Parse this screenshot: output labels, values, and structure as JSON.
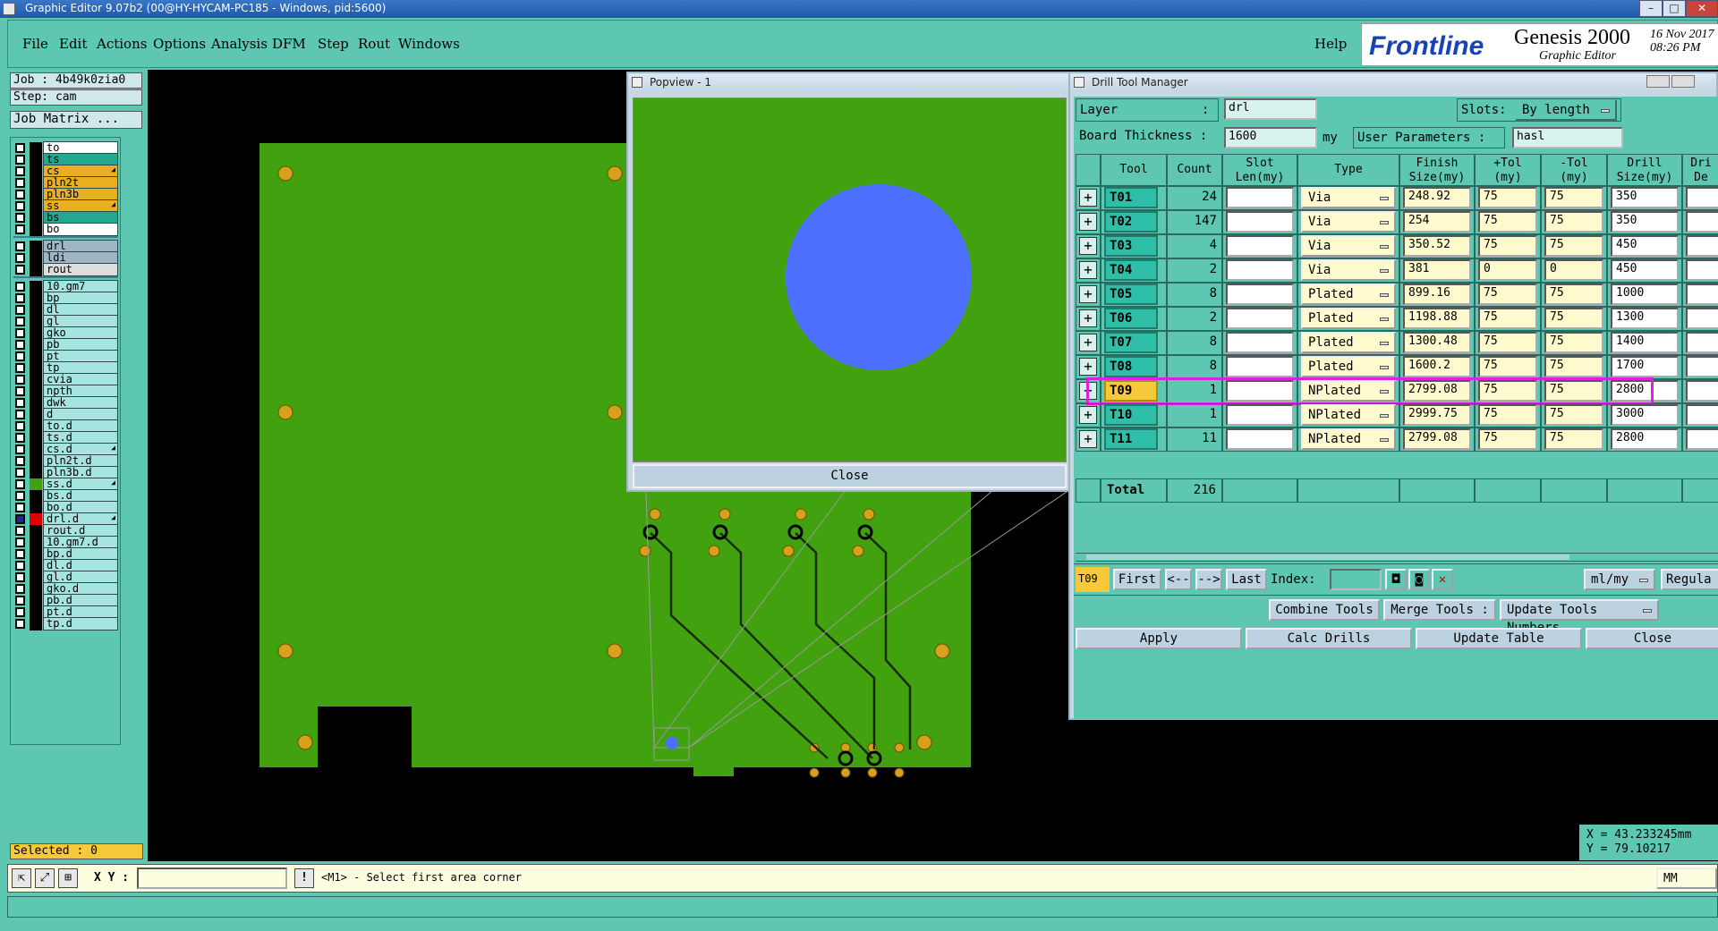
{
  "window": {
    "title": "Graphic Editor 9.07b2 (00@HY-HYCAM-PC185 - Windows, pid:5600)"
  },
  "menu": [
    "File",
    "Edit",
    "Actions",
    "Options",
    "Analysis",
    "DFM",
    "Step",
    "Rout",
    "Windows"
  ],
  "help_label": "Help",
  "brand": {
    "logo": "Frontline",
    "product": "Genesis 2000",
    "sub": "Graphic Editor",
    "date": "16 Nov 2017",
    "time": "08:26 PM"
  },
  "left": {
    "job": "Job : 4b49k0zia0",
    "step": "Step: cam",
    "job_matrix": "Job Matrix ...",
    "selected": "Selected : 0"
  },
  "layers": [
    {
      "name": "to",
      "color": "#ffffff",
      "g": 0
    },
    {
      "name": "ts",
      "color": "#23a98f",
      "g": 0
    },
    {
      "name": "cs",
      "color": "#e8b020",
      "g": 0,
      "mark": true
    },
    {
      "name": "pln2t",
      "color": "#e8b020",
      "g": 0
    },
    {
      "name": "pln3b",
      "color": "#e8b020",
      "g": 0
    },
    {
      "name": "ss",
      "color": "#e8b020",
      "g": 0,
      "mark": true
    },
    {
      "name": "bs",
      "color": "#23a98f",
      "g": 0
    },
    {
      "name": "bo",
      "color": "#ffffff",
      "g": 0
    },
    {
      "name": "drl",
      "color": "#9fb6c6",
      "g": 1
    },
    {
      "name": "ldi",
      "color": "#9fb6c6",
      "g": 1
    },
    {
      "name": "rout",
      "color": "#dddddd",
      "g": 1
    },
    {
      "name": "10.gm7",
      "color": "#a6e4e0",
      "g": 2
    },
    {
      "name": "bp",
      "color": "#a6e4e0",
      "g": 2
    },
    {
      "name": "dl",
      "color": "#a6e4e0",
      "g": 2
    },
    {
      "name": "gl",
      "color": "#a6e4e0",
      "g": 2
    },
    {
      "name": "gko",
      "color": "#a6e4e0",
      "g": 2
    },
    {
      "name": "pb",
      "color": "#a6e4e0",
      "g": 2
    },
    {
      "name": "pt",
      "color": "#a6e4e0",
      "g": 2
    },
    {
      "name": "tp",
      "color": "#a6e4e0",
      "g": 2
    },
    {
      "name": "cvia",
      "color": "#a6e4e0",
      "g": 2
    },
    {
      "name": "npth",
      "color": "#a6e4e0",
      "g": 2
    },
    {
      "name": "dwk",
      "color": "#a6e4e0",
      "g": 2
    },
    {
      "name": "d",
      "color": "#a6e4e0",
      "g": 2
    },
    {
      "name": "to.d",
      "color": "#a6e4e0",
      "g": 2
    },
    {
      "name": "ts.d",
      "color": "#a6e4e0",
      "g": 2
    },
    {
      "name": "cs.d",
      "color": "#a6e4e0",
      "g": 2,
      "mark": true
    },
    {
      "name": "pln2t.d",
      "color": "#a6e4e0",
      "g": 2
    },
    {
      "name": "pln3b.d",
      "color": "#a6e4e0",
      "g": 2
    },
    {
      "name": "ss.d",
      "color": "#a6e4e0",
      "g": 2,
      "mark": true,
      "sw": "#41a10f"
    },
    {
      "name": "bs.d",
      "color": "#a6e4e0",
      "g": 2
    },
    {
      "name": "bo.d",
      "color": "#a6e4e0",
      "g": 2
    },
    {
      "name": "drl.d",
      "color": "#a6e4e0",
      "g": 2,
      "mark": true,
      "sw": "#e00000"
    },
    {
      "name": "rout.d",
      "color": "#a6e4e0",
      "g": 2
    },
    {
      "name": "10.gm7.d",
      "color": "#a6e4e0",
      "g": 2
    },
    {
      "name": "bp.d",
      "color": "#a6e4e0",
      "g": 2
    },
    {
      "name": "dl.d",
      "color": "#a6e4e0",
      "g": 2
    },
    {
      "name": "gl.d",
      "color": "#a6e4e0",
      "g": 2
    },
    {
      "name": "gko.d",
      "color": "#a6e4e0",
      "g": 2
    },
    {
      "name": "pb.d",
      "color": "#a6e4e0",
      "g": 2
    },
    {
      "name": "pt.d",
      "color": "#a6e4e0",
      "g": 2
    },
    {
      "name": "tp.d",
      "color": "#a6e4e0",
      "g": 2
    }
  ],
  "popview": {
    "title": "Popview - 1",
    "close": "Close"
  },
  "dtm": {
    "title": "Drill Tool Manager",
    "layer_label": "Layer",
    "layer_colon": ":",
    "layer_value": "drl",
    "slots_label": "Slots:",
    "slots_value": "By length",
    "board_label": "Board Thickness :",
    "board_value": "1600",
    "board_unit": "my",
    "user_params": "User Parameters :",
    "user_value": "hasl",
    "headers": [
      "Tool",
      "Count",
      "Slot Len(my)",
      "Type",
      "Finish Size(my)",
      "+Tol (my)",
      "-Tol (my)",
      "Drill Size(my)",
      "Dri De"
    ],
    "rows": [
      {
        "tool": "T01",
        "count": "24",
        "type": "Via",
        "finish": "248.92",
        "ptol": "75",
        "mtol": "75",
        "drill": "350"
      },
      {
        "tool": "T02",
        "count": "147",
        "type": "Via",
        "finish": "254",
        "ptol": "75",
        "mtol": "75",
        "drill": "350"
      },
      {
        "tool": "T03",
        "count": "4",
        "type": "Via",
        "finish": "350.52",
        "ptol": "75",
        "mtol": "75",
        "drill": "450"
      },
      {
        "tool": "T04",
        "count": "2",
        "type": "Via",
        "finish": "381",
        "ptol": "0",
        "mtol": "0",
        "drill": "450"
      },
      {
        "tool": "T05",
        "count": "8",
        "type": "Plated",
        "finish": "899.16",
        "ptol": "75",
        "mtol": "75",
        "drill": "1000"
      },
      {
        "tool": "T06",
        "count": "2",
        "type": "Plated",
        "finish": "1198.88",
        "ptol": "75",
        "mtol": "75",
        "drill": "1300"
      },
      {
        "tool": "T07",
        "count": "8",
        "type": "Plated",
        "finish": "1300.48",
        "ptol": "75",
        "mtol": "75",
        "drill": "1400"
      },
      {
        "tool": "T08",
        "count": "8",
        "type": "Plated",
        "finish": "1600.2",
        "ptol": "75",
        "mtol": "75",
        "drill": "1700"
      },
      {
        "tool": "T09",
        "count": "1",
        "type": "NPlated",
        "finish": "2799.08",
        "ptol": "75",
        "mtol": "75",
        "drill": "2800",
        "selected": true
      },
      {
        "tool": "T10",
        "count": "1",
        "type": "NPlated",
        "finish": "2999.75",
        "ptol": "75",
        "mtol": "75",
        "drill": "3000"
      },
      {
        "tool": "T11",
        "count": "11",
        "type": "NPlated",
        "finish": "2799.08",
        "ptol": "75",
        "mtol": "75",
        "drill": "2800"
      }
    ],
    "total_label": "Total",
    "total_value": "216",
    "current_tool": "T09",
    "nav": {
      "first": "First",
      "prev": "<--",
      "next": "-->",
      "last": "Last",
      "index": "Index:",
      "units": "ml/my",
      "regular": "Regula"
    },
    "actions": {
      "combine": "Combine Tools",
      "merge": "Merge Tools :",
      "update_numbers": "Update Tools Numbers",
      "apply": "Apply",
      "calc": "Calc Drills",
      "update_table": "Update Table",
      "close": "Close"
    }
  },
  "coords": {
    "x": "X = 43.233245mm",
    "y": "Y = 79.10217"
  },
  "cmd": {
    "xy_label": "X Y :",
    "prompt": "<M1> - Select first area corner",
    "unit": "MM"
  },
  "colors": {
    "board": "#41a10f",
    "pad": "#d6a11d",
    "highlight": "#e020e0"
  }
}
